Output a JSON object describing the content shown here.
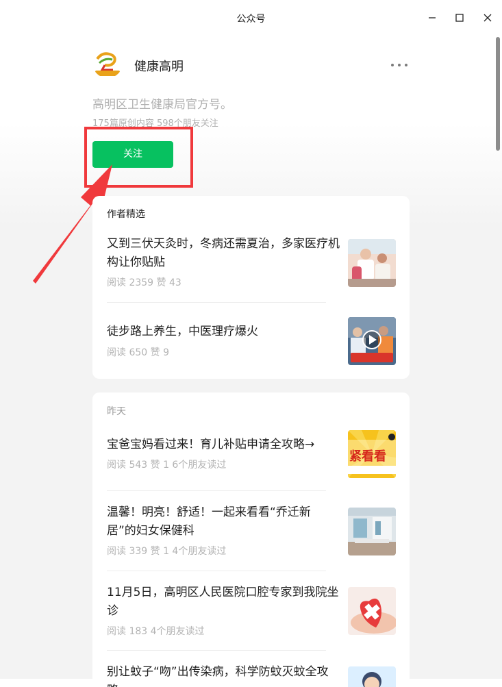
{
  "window": {
    "title": "公众号",
    "controls": [
      "minimize-icon",
      "maximize-icon",
      "close-icon"
    ]
  },
  "account": {
    "name": "健康高明",
    "logo_text": "健康高明",
    "description": "高明区卫生健康局官方号。",
    "stats": "175篇原创内容   598个朋友关注",
    "follow_label": "关注",
    "more_icon": "more-horizontal-icon"
  },
  "featured": {
    "title": "作者精选",
    "items": [
      {
        "title": "又到三伏天灸时，冬病还需夏治，多家医疗机构让你贴贴",
        "meta": "阅读 2359   赞 43"
      },
      {
        "title": "徒步路上养生，中医理疗爆火",
        "meta": "阅读 650   赞 9",
        "thumb_caption": "中医理疗爆火"
      }
    ]
  },
  "yesterday": {
    "title": "昨天",
    "items": [
      {
        "title": "宝爸宝妈看过来！育儿补贴申请全攻略→",
        "meta": "阅读 543   赞 1   6个朋友读过",
        "thumb_text": "紧看看"
      },
      {
        "title": "温馨！明亮！舒适！一起来看看“乔迁新居”的妇女保健科",
        "meta": "阅读 339   赞 1   4个朋友读过"
      },
      {
        "title": "11月5日，高明区人民医院口腔专家到我院坐诊",
        "meta": "阅读 183   4个朋友读过"
      },
      {
        "title": "别让蚊子“吻”出传染病，科学防蚊灭蚊全攻略",
        "meta": ""
      }
    ]
  },
  "colors": {
    "follow_green": "#07c160",
    "highlight_red": "#f0393c"
  }
}
